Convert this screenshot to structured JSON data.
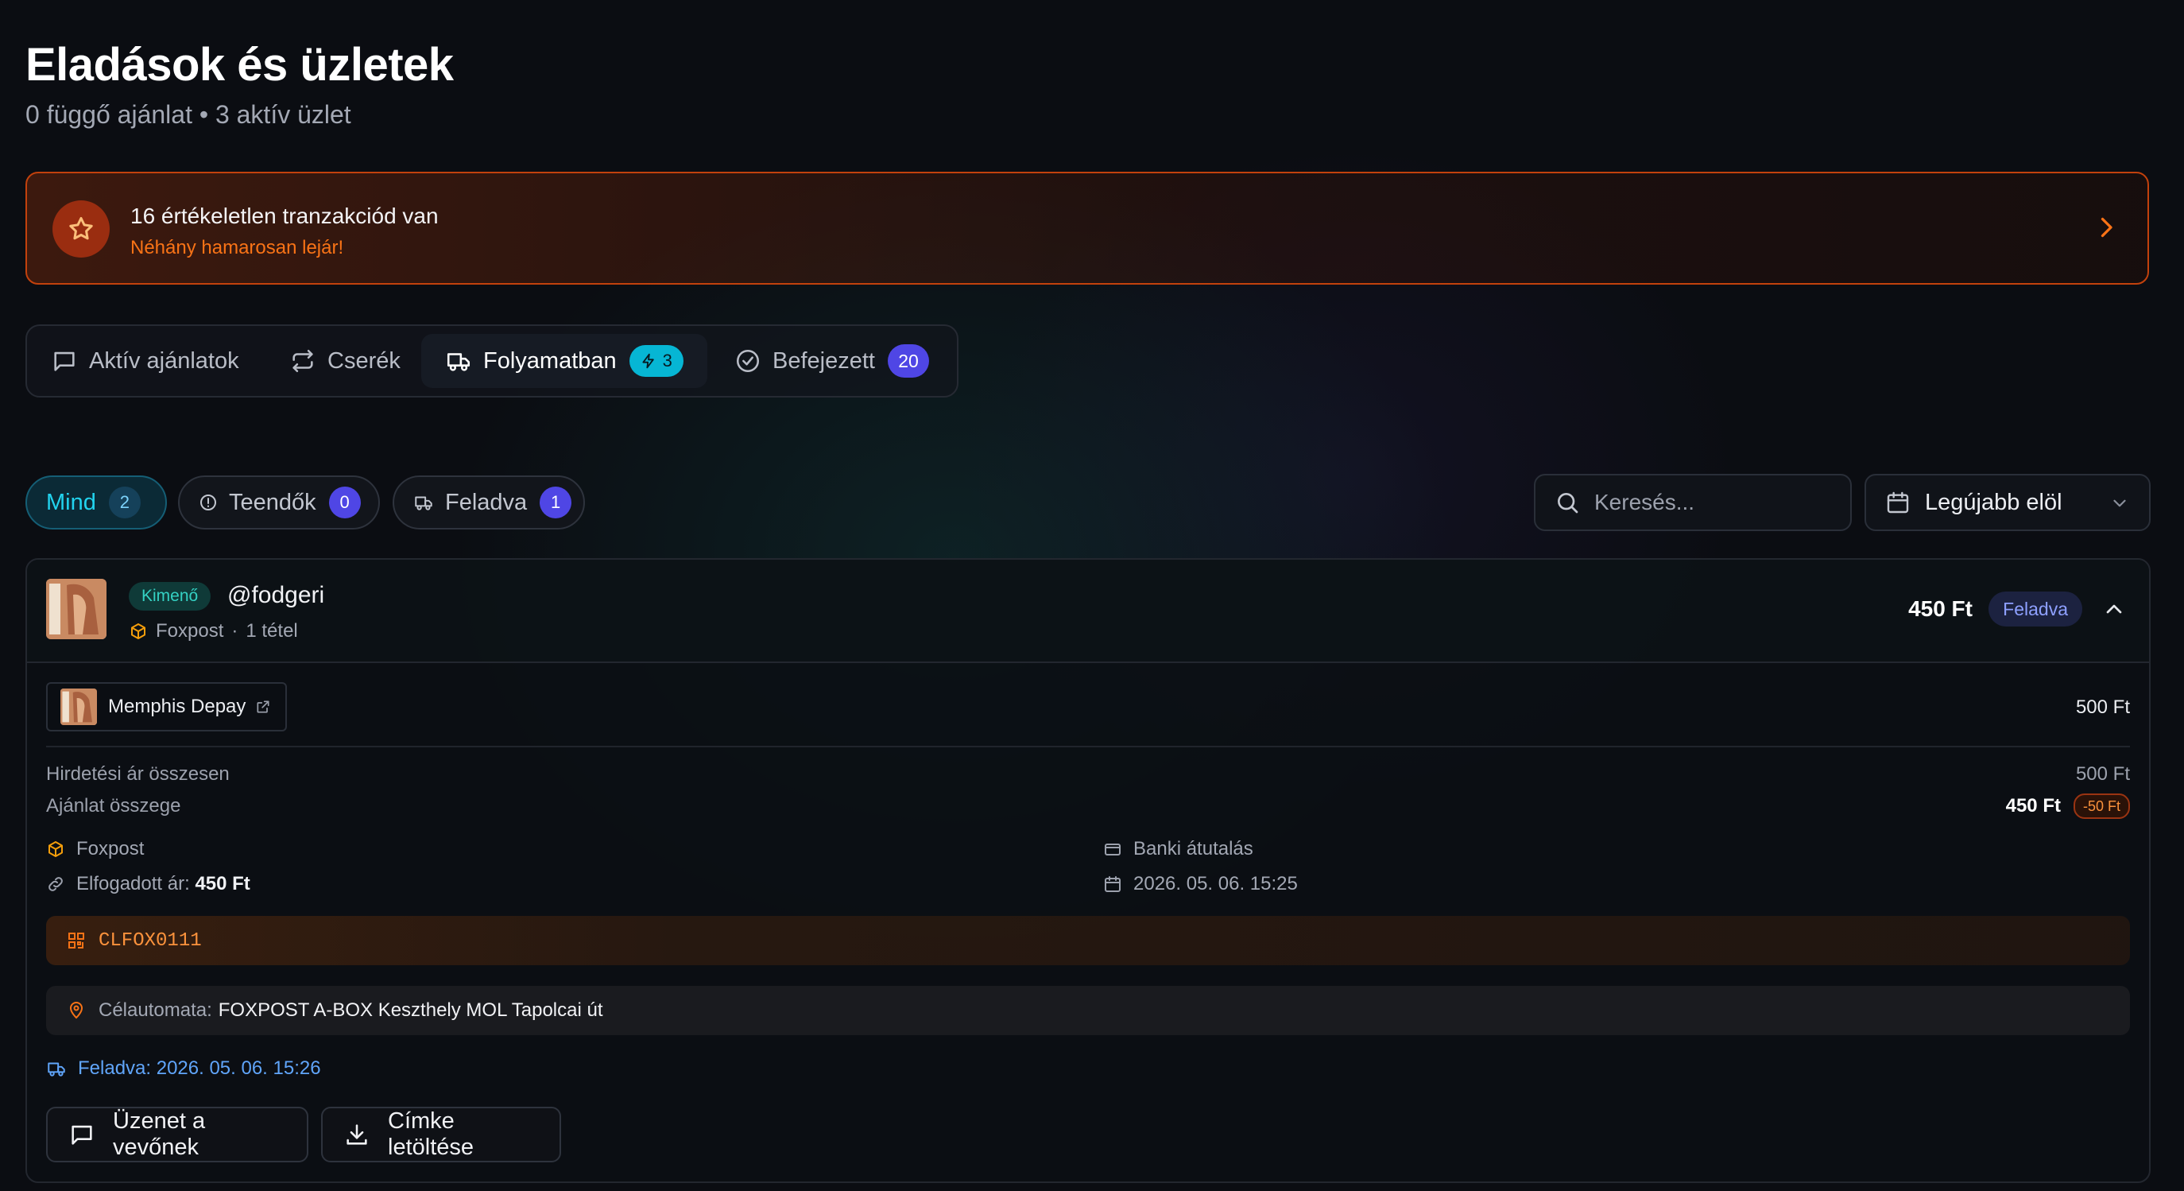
{
  "header": {
    "title": "Eladások és üzletek",
    "subtitle": "0 függő ajánlat • 3 aktív üzlet"
  },
  "alert": {
    "icon": "star-icon",
    "title": "16 értékeletlen tranzakciód van",
    "subtitle": "Néhány hamarosan lejár!"
  },
  "tabs": [
    {
      "label": "Aktív ajánlatok",
      "icon": "chat-icon"
    },
    {
      "label": "Cserék",
      "icon": "swap-icon"
    },
    {
      "label": "Folyamatban",
      "icon": "truck-icon",
      "badge": "3",
      "active": true
    },
    {
      "label": "Befejezett",
      "icon": "check-circle-icon",
      "badge": "20"
    }
  ],
  "filters": [
    {
      "label": "Mind",
      "count": "2",
      "active": true
    },
    {
      "label": "Teendők",
      "count": "0",
      "icon": "alert-circle-icon"
    },
    {
      "label": "Feladva",
      "count": "1",
      "icon": "truck-icon"
    }
  ],
  "search": {
    "placeholder": "Keresés..."
  },
  "sort": {
    "value": "Legújabb elöl"
  },
  "order": {
    "direction_tag": "Kimenő",
    "user": "@fodgeri",
    "shipping_method": "Foxpost",
    "separator": "·",
    "item_count": "1 tétel",
    "total": "450 Ft",
    "status": "Feladva",
    "item": {
      "name": "Memphis Depay",
      "price": "500 Ft"
    },
    "listing_total_label": "Hirdetési ár összesen",
    "listing_total_value": "500 Ft",
    "offer_label": "Ajánlat összege",
    "offer_value": "450 Ft",
    "offer_diff": "-50 Ft",
    "shipping_label": "Foxpost",
    "accepted_label": "Elfogadott ár:",
    "accepted_value": "450 Ft",
    "payment_method": "Banki átutalás",
    "date": "2026. 05. 06. 15:25",
    "tracking_code": "CLFOX0111",
    "destination_label": "Célautomata:",
    "destination_value": "FOXPOST A-BOX Keszthely MOL Tapolcai út",
    "shipped_text": "Feladva: 2026. 05. 06. 15:26",
    "buttons": {
      "message": "Üzenet a vevőnek",
      "label_download": "Címke letöltése"
    }
  },
  "colors": {
    "accent_orange": "#f97316",
    "accent_cyan": "#06b6d4",
    "accent_indigo": "#4f46e5",
    "link_blue": "#60a5fa"
  }
}
